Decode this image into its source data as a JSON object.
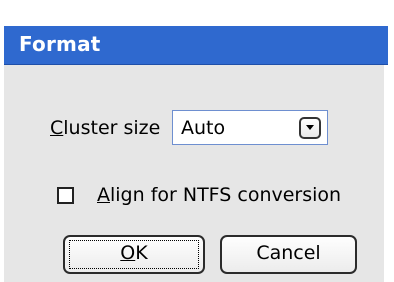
{
  "window": {
    "title": "Format"
  },
  "cluster": {
    "label_prefix": "C",
    "label_rest": "luster size",
    "selected": "Auto",
    "dropdown_icon": "chevron-down-icon"
  },
  "align": {
    "checked": false,
    "label_prefix": "A",
    "label_rest": "lign for NTFS conversion"
  },
  "buttons": {
    "ok_prefix": "O",
    "ok_rest": "K",
    "cancel": "Cancel"
  },
  "colors": {
    "titlebar": "#2f69cf",
    "panel": "#e6e6e6"
  }
}
